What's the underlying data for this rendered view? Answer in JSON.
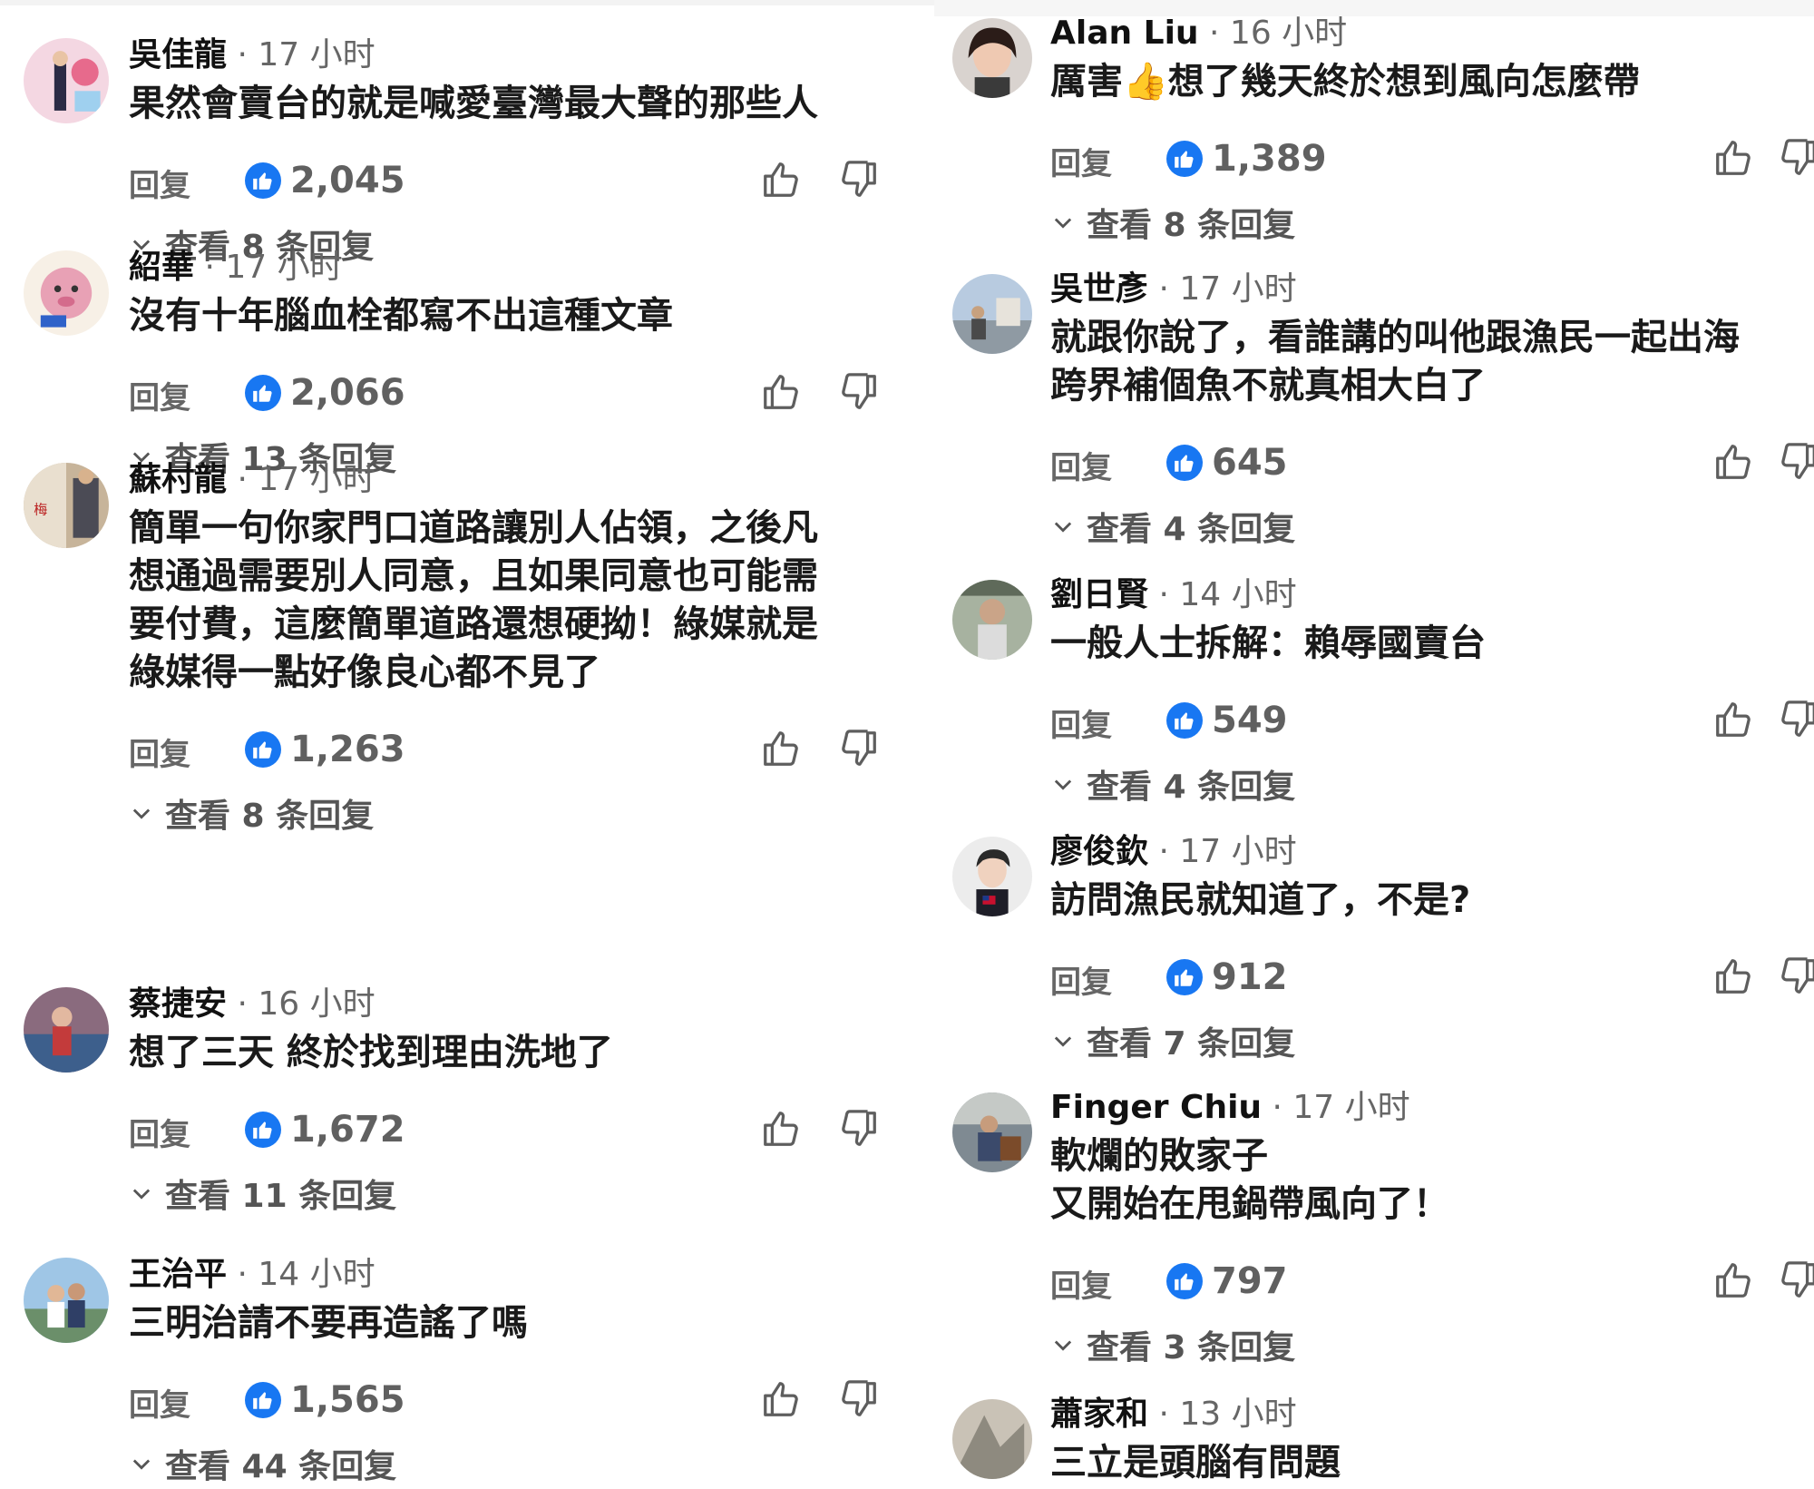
{
  "ui": {
    "reply_label": "回复",
    "colors": {
      "like_badge": "#1877f2",
      "text": "#1a1a1a",
      "muted": "#666666"
    }
  },
  "left": [
    {
      "author": "吳佳龍",
      "time": "17 小时",
      "text": "果然會賣台的就是喊愛臺灣最大聲的那些人",
      "likes": "2,045",
      "replies": "查看 8 条回复"
    },
    {
      "author": "紹華",
      "time": "17 小时",
      "text": "沒有十年腦血栓都寫不出這種文章",
      "likes": "2,066",
      "replies": "查看 13 条回复"
    },
    {
      "author": "蘇村龍",
      "time": "17 小时",
      "text": "簡單一句你家門口道路讓別人佔領，之後凡\n想通過需要別人同意，且如果同意也可能需\n要付費，這麼簡單道路還想硬拗！綠媒就是\n綠媒得一點好像良心都不見了",
      "likes": "1,263",
      "replies": "查看 8 条回复"
    },
    {
      "author": "蔡捷安",
      "time": "16 小时",
      "text": "想了三天 終於找到理由洗地了",
      "likes": "1,672",
      "replies": "查看 11 条回复"
    },
    {
      "author": "王治平",
      "time": "14 小时",
      "text": "三明治請不要再造謠了嗎",
      "likes": "1,565",
      "replies": "查看 44 条回复"
    }
  ],
  "right": [
    {
      "author": "Alan Liu",
      "time": "16 小时",
      "text": "厲害👍想了幾天終於想到風向怎麼帶",
      "likes": "1,389",
      "replies": "查看 8 条回复"
    },
    {
      "author": "吳世彥",
      "time": "17 小时",
      "text": "就跟你說了，看誰講的叫他跟漁民一起出海\n跨界補個魚不就真相大白了",
      "likes": "645",
      "replies": "查看 4 条回复"
    },
    {
      "author": "劉日賢",
      "time": "14 小时",
      "text": "一般人士拆解：賴辱國賣台",
      "likes": "549",
      "replies": "查看 4 条回复"
    },
    {
      "author": "廖俊欽",
      "time": "17 小时",
      "text": "訪問漁民就知道了，不是?",
      "likes": "912",
      "replies": "查看 7 条回复"
    },
    {
      "author": "Finger Chiu",
      "time": "17 小时",
      "text": "軟爛的敗家子\n又開始在甩鍋帶風向了！",
      "likes": "797",
      "replies": "查看 3 条回复"
    },
    {
      "author": "蕭家和",
      "time": "13 小时",
      "text": "三立是頭腦有問題"
    }
  ]
}
